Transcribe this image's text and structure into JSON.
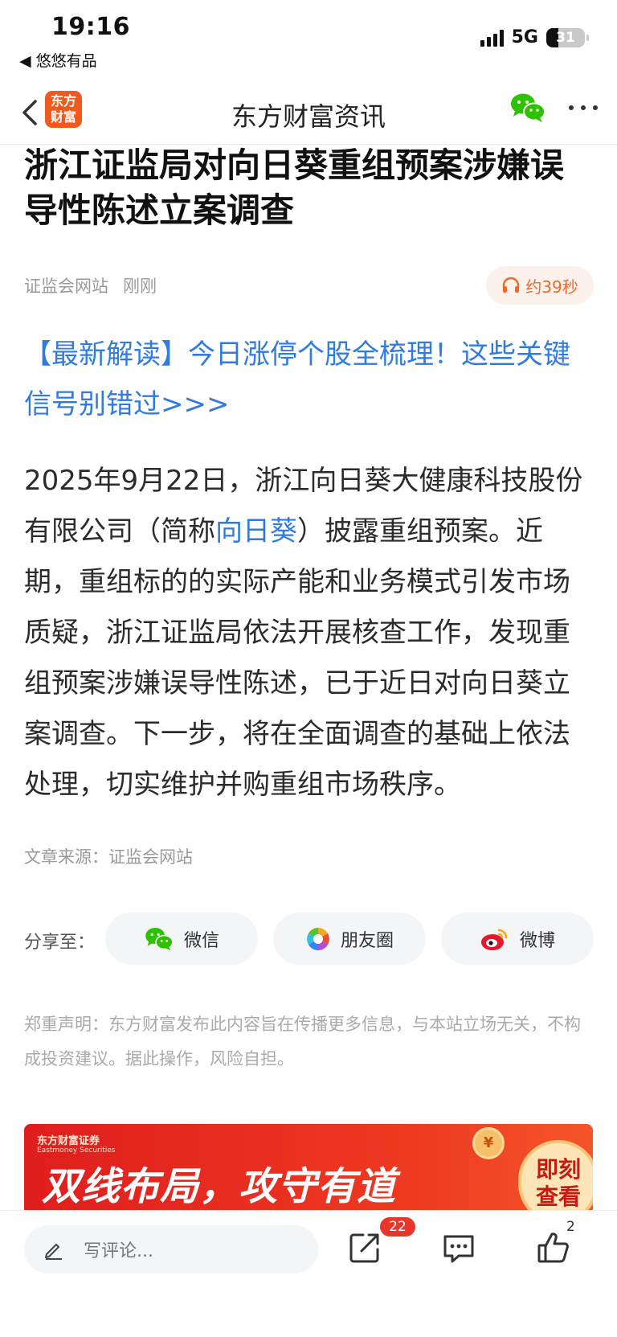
{
  "status_bar": {
    "time": "19:16",
    "back_app": "◀ 悠悠有品",
    "network": "5G",
    "battery": "31",
    "battery_level": 0.31
  },
  "nav": {
    "logo_line1": "东方",
    "logo_line2": "财富",
    "title": "东方财富资讯"
  },
  "article": {
    "headline": "浙江证监局对向日葵重组预案涉嫌误导性陈述立案调查",
    "source_name": "证监会网站",
    "time": "刚刚",
    "audio_label": "约39秒",
    "promo": "【最新解读】今日涨停个股全梳理！这些关键信号别错过>>>",
    "body_part1": "2025年9月22日，浙江向日葵大健康科技股份有限公司（简称",
    "body_link": "向日葵",
    "body_part2": "）披露重组预案。近期，重组标的的实际产能和业务模式引发市场质疑，浙江证监局依法开展核查工作，发现重组预案涉嫌误导性陈述，已于近日对向日葵立案调查。下一步，将在全面调查的基础上依法处理，切实维护并购重组市场秩序。",
    "article_source": "文章来源：证监会网站"
  },
  "share": {
    "label": "分享至：",
    "wechat": "微信",
    "moments": "朋友圈",
    "weibo": "微博"
  },
  "disclaimer": {
    "title": "郑重声明：",
    "text": "东方财富发布此内容旨在传播更多信息，与本站立场无关，不构成投资建议。据此操作，风险自担。"
  },
  "banner": {
    "brand": "东方财富证券",
    "brand_en": "Eastmoney Securities",
    "slogan": "双线布局，攻守有道",
    "cta_line1": "即刻",
    "cta_line2": "查看",
    "coin_symbol": "¥"
  },
  "bottom_bar": {
    "comment_placeholder": "写评论...",
    "share_count": "22",
    "like_count": "2"
  },
  "colors": {
    "link_blue": "#2f7be0",
    "brand_orange": "#f05a1f",
    "audio_orange": "#ec6a2c",
    "badge_red": "#e8362d",
    "wechat_green": "#2dc100"
  }
}
